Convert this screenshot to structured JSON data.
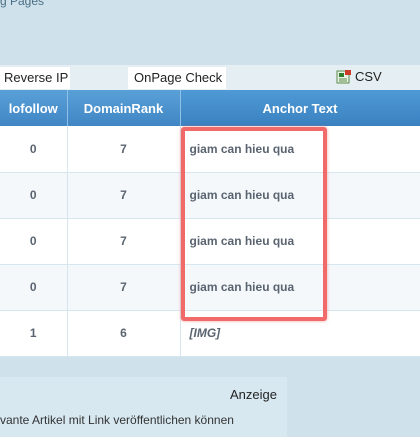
{
  "top": {
    "partial_text": "g Pages"
  },
  "tabs": {
    "reverse_ip": "Reverse IP",
    "onpage_check": "OnPage Check"
  },
  "export": {
    "csv_label": "CSV",
    "icon": "spreadsheet-icon"
  },
  "table": {
    "headers": {
      "nofollow": "lofollow",
      "domainrank": "DomainRank",
      "anchor": "Anchor Text"
    },
    "rows": [
      {
        "nofollow": "0",
        "domainrank": "7",
        "anchor": "giam can hieu qua"
      },
      {
        "nofollow": "0",
        "domainrank": "7",
        "anchor": "giam can hieu qua"
      },
      {
        "nofollow": "0",
        "domainrank": "7",
        "anchor": "giam can hieu qua"
      },
      {
        "nofollow": "0",
        "domainrank": "7",
        "anchor": "giam can hieu qua"
      },
      {
        "nofollow": "1",
        "domainrank": "6",
        "anchor": "[IMG]"
      }
    ]
  },
  "ad": {
    "label": "Anzeige",
    "text": "vante Artikel mit Link veröffentlichen können"
  },
  "colors": {
    "header_blue": "#3f86c4",
    "highlight_red": "#f06a6a",
    "page_bg": "#cfe1ea"
  }
}
